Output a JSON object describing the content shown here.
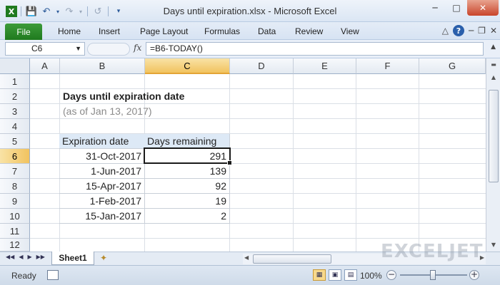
{
  "window": {
    "title": "Days until expiration.xlsx - Microsoft Excel"
  },
  "ribbon": {
    "file_label": "File",
    "tabs": [
      "Home",
      "Insert",
      "Page Layout",
      "Formulas",
      "Data",
      "Review",
      "View"
    ]
  },
  "formula_bar": {
    "name_box": "C6",
    "fx_label": "fx",
    "formula": "=B6-TODAY()"
  },
  "columns": [
    "A",
    "B",
    "C",
    "D",
    "E",
    "F",
    "G"
  ],
  "rows": [
    "1",
    "2",
    "3",
    "4",
    "5",
    "6",
    "7",
    "8",
    "9",
    "10",
    "11",
    "12"
  ],
  "sheet": {
    "title": "Days until expiration date",
    "subtitle": "(as of Jan 13, 2017)",
    "headers": {
      "expiration": "Expiration date",
      "days": "Days remaining"
    },
    "data": [
      {
        "date": "31-Oct-2017",
        "days": "291"
      },
      {
        "date": "1-Jun-2017",
        "days": "139"
      },
      {
        "date": "15-Apr-2017",
        "days": "92"
      },
      {
        "date": "1-Feb-2017",
        "days": "19"
      },
      {
        "date": "15-Jan-2017",
        "days": "2"
      }
    ]
  },
  "sheet_tabs": {
    "active": "Sheet1"
  },
  "brand": "EXCELJET",
  "status": {
    "ready": "Ready",
    "zoom": "100%"
  },
  "colors": {
    "accent_file": "#2b8a2a",
    "selected_header": "#f5cf7a",
    "table_header": "#dde9f6"
  },
  "icons": [
    "save-icon",
    "undo-icon",
    "redo-icon",
    "help-icon",
    "minimize-icon",
    "maximize-icon",
    "close-icon",
    "new-sheet-icon"
  ]
}
